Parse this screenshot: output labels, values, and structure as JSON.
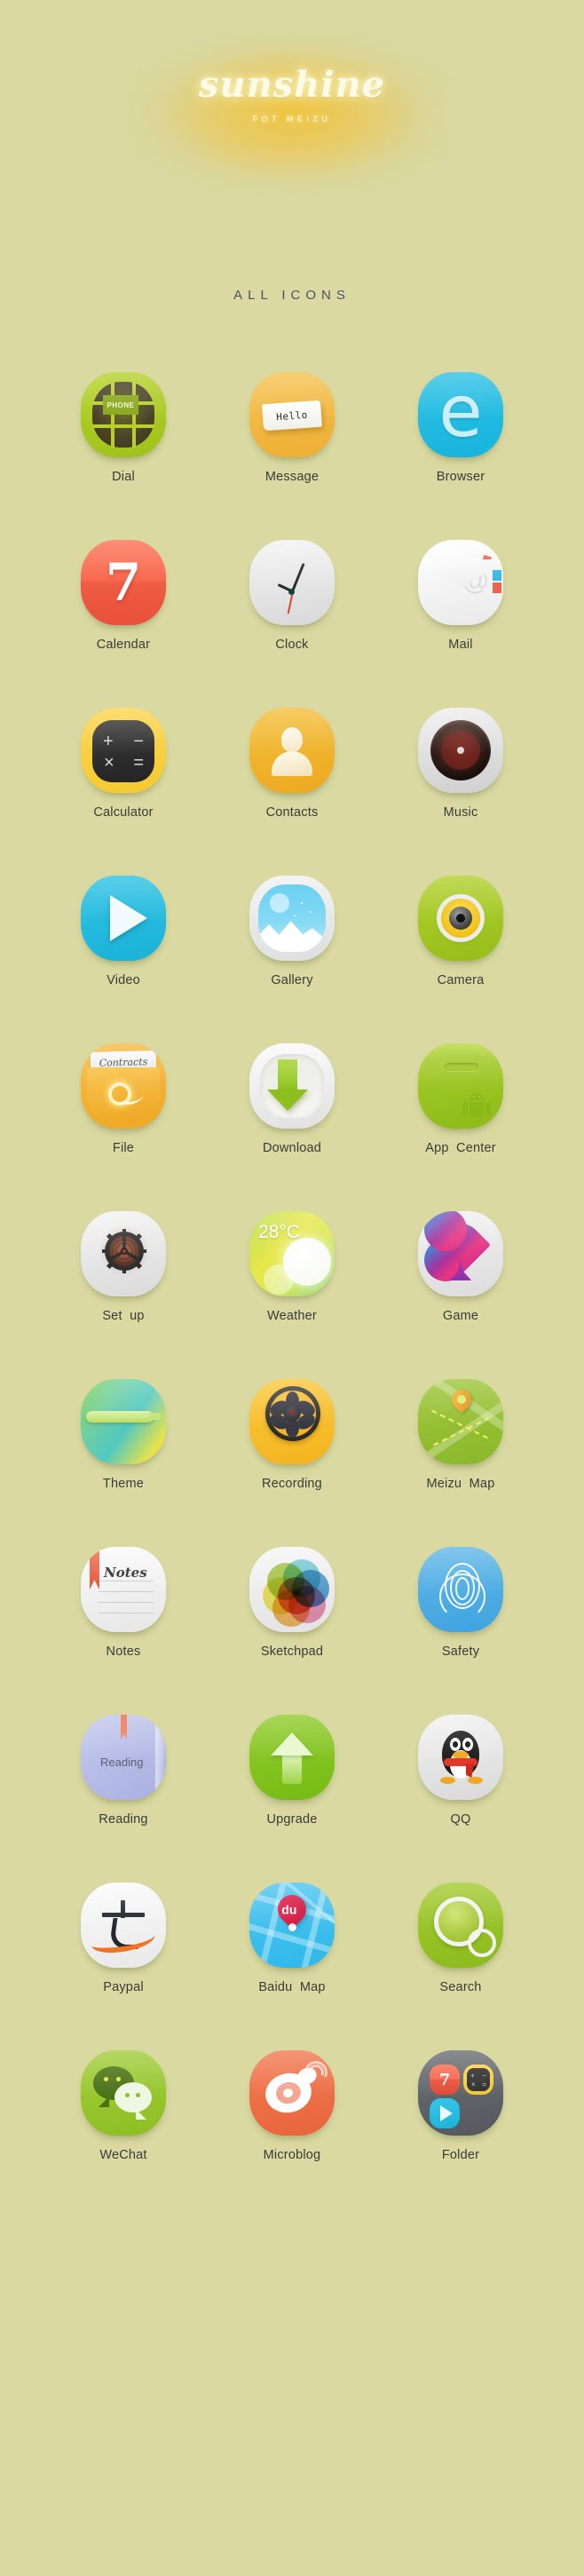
{
  "hero": {
    "brand": "sunshine",
    "subtitle": "FOT MEIZU"
  },
  "section": {
    "title": "ALL ICONS"
  },
  "colors": {
    "background": "#d9d9a1",
    "label_text": "#3a3a3a",
    "section_title": "#4c4f5a",
    "glow": "#f0c43c"
  },
  "icons": [
    {
      "label": "Dial",
      "icon_name": "dial-icon",
      "inner_text": "PHONE",
      "accent": "#b6d22a"
    },
    {
      "label": "Message",
      "icon_name": "message-icon",
      "inner_text": "Hello",
      "accent": "#f6c352"
    },
    {
      "label": "Browser",
      "icon_name": "browser-icon",
      "inner_text": "e",
      "accent": "#2ec2e6"
    },
    {
      "label": "Calendar",
      "icon_name": "calendar-icon",
      "inner_text": "7",
      "accent": "#f9644a"
    },
    {
      "label": "Clock",
      "icon_name": "clock-icon",
      "inner_text": "",
      "accent": "#e4e4e4"
    },
    {
      "label": "Mail",
      "icon_name": "mail-icon",
      "inner_text": "@",
      "accent": "#f2f2f2"
    },
    {
      "label": "Calculator",
      "icon_name": "calculator-icon",
      "inner_text": "+ − × =",
      "accent": "#fbd54e"
    },
    {
      "label": "Contacts",
      "icon_name": "contacts-icon",
      "inner_text": "",
      "accent": "#f2b62c"
    },
    {
      "label": "Music",
      "icon_name": "music-icon",
      "inner_text": "",
      "accent": "#dedede"
    },
    {
      "label": "Video",
      "icon_name": "video-icon",
      "inner_text": "",
      "accent": "#2fc3e4"
    },
    {
      "label": "Gallery",
      "icon_name": "gallery-icon",
      "inner_text": "",
      "accent": "#4fc7ef"
    },
    {
      "label": "Camera",
      "icon_name": "camera-icon",
      "inner_text": "",
      "accent": "#a6c828"
    },
    {
      "label": "File",
      "icon_name": "file-icon",
      "inner_text": "Contracts",
      "accent": "#f3b434"
    },
    {
      "label": "Download",
      "icon_name": "download-icon",
      "inner_text": "",
      "accent": "#8dc01e"
    },
    {
      "label": "App  Center",
      "icon_name": "app-center-icon",
      "inner_text": "",
      "accent": "#9cc51f"
    },
    {
      "label": "Set  up",
      "icon_name": "settings-gear-icon",
      "inner_text": "",
      "accent": "#e7e7e7"
    },
    {
      "label": "Weather",
      "icon_name": "weather-icon",
      "inner_text": "28°C",
      "accent": "#d9e84f"
    },
    {
      "label": "Game",
      "icon_name": "game-spade-icon",
      "inner_text": "",
      "accent": "#cc3b8e"
    },
    {
      "label": "Theme",
      "icon_name": "theme-icon",
      "inner_text": "",
      "accent": "#6fd0a0"
    },
    {
      "label": "Recording",
      "icon_name": "recording-icon",
      "inner_text": "",
      "accent": "#f7bf2e"
    },
    {
      "label": "Meizu  Map",
      "icon_name": "meizu-map-icon",
      "inner_text": "",
      "accent": "#95c033"
    },
    {
      "label": "Notes",
      "icon_name": "notes-icon",
      "inner_text": "Notes",
      "accent": "#f0f0f0"
    },
    {
      "label": "Sketchpad",
      "icon_name": "sketchpad-icon",
      "inner_text": "",
      "accent": "#ececec"
    },
    {
      "label": "Safety",
      "icon_name": "safety-fingerprint-icon",
      "inner_text": "",
      "accent": "#4ea9e3"
    },
    {
      "label": "Reading",
      "icon_name": "reading-icon",
      "inner_text": "Reading",
      "accent": "#b4bce6"
    },
    {
      "label": "Upgrade",
      "icon_name": "upgrade-icon",
      "inner_text": "",
      "accent": "#83c420"
    },
    {
      "label": "QQ",
      "icon_name": "qq-penguin-icon",
      "inner_text": "",
      "accent": "#e5e5e5"
    },
    {
      "label": "Paypal",
      "icon_name": "paypal-alipay-icon",
      "inner_text": "支",
      "accent": "#ef7322"
    },
    {
      "label": "Baidu  Map",
      "icon_name": "baidu-map-icon",
      "inner_text": "du",
      "accent": "#2fb8ea"
    },
    {
      "label": "Search",
      "icon_name": "search-icon",
      "inner_text": "",
      "accent": "#98c328"
    },
    {
      "label": "WeChat",
      "icon_name": "wechat-icon",
      "inner_text": "",
      "accent": "#8cbf22"
    },
    {
      "label": "Microblog",
      "icon_name": "microblog-weibo-icon",
      "inner_text": "",
      "accent": "#e9653c"
    },
    {
      "label": "Folder",
      "icon_name": "folder-icon",
      "inner_text": "7",
      "accent": "#5d6166"
    }
  ]
}
